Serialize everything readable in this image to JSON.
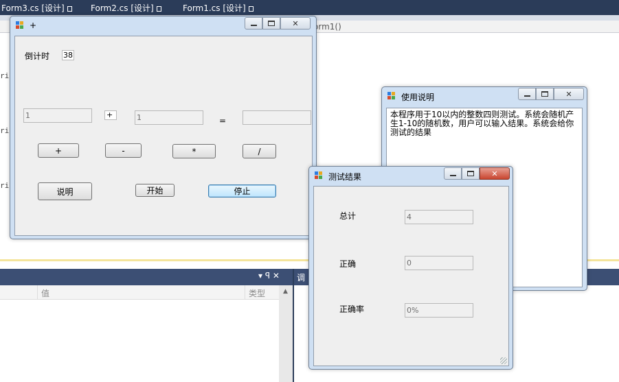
{
  "ide": {
    "tabs": [
      {
        "label": "Form3.cs [设计]"
      },
      {
        "label": "Form2.cs [设计]"
      },
      {
        "label": "Form1.cs [设计]"
      }
    ],
    "method_dropdown": "orm1()",
    "gutter": [
      "ri",
      "ri",
      "ri"
    ],
    "left_panel": {
      "pin_label": "▾ ꟼ ✕",
      "columns": [
        "值",
        "类型"
      ]
    },
    "right_panel": {
      "title": "调"
    }
  },
  "form1": {
    "title": "+",
    "countdown_label": "倒计时",
    "countdown_value": "38",
    "operand1": "1",
    "operator": "+",
    "operand2": "1",
    "equals": "=",
    "result": "",
    "buttons": {
      "plus": "+",
      "minus": "-",
      "multiply": "*",
      "divide": "/",
      "help": "说明",
      "start": "开始",
      "stop": "停止"
    }
  },
  "help_window": {
    "title": "使用说明",
    "text": "本程序用于10以内的整数四则测试。系统会随机产生1-10的随机数，用户可以输入结果。系统会给你测试的结果"
  },
  "result_window": {
    "title": "测试结果",
    "total_label": "总计",
    "total_value": "4",
    "correct_label": "正确",
    "correct_value": "0",
    "rate_label": "正确率",
    "rate_value": "0%"
  }
}
